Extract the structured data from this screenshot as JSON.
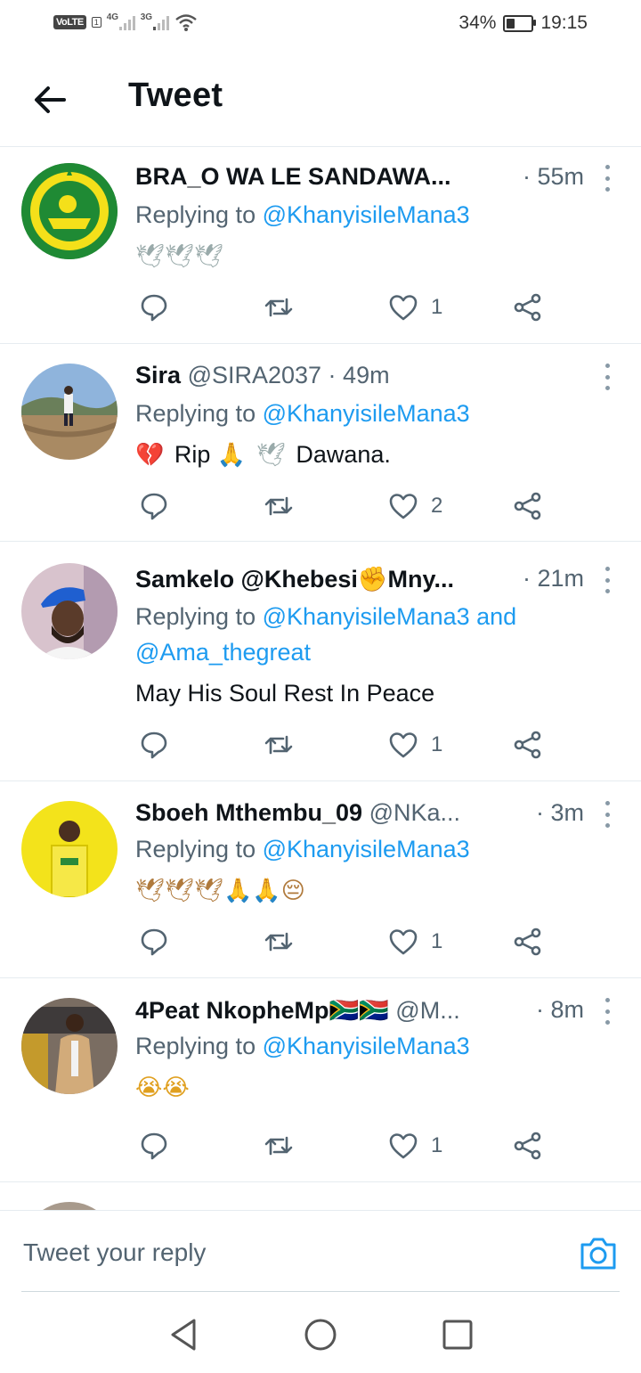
{
  "status_bar": {
    "volte": "VoLTE",
    "sim_slot": "1",
    "net1": "4G",
    "net2": "3G",
    "battery_pct": "34%",
    "battery_level": 0.34,
    "time": "19:15"
  },
  "header": {
    "back_icon": "arrow-left-icon",
    "title": "Tweet"
  },
  "tweets": [
    {
      "name": "BRA_O WA LE SANDAWA...",
      "handle": "",
      "time": "· 55m",
      "replying_prefix": "Replying to ",
      "mentions": "@KhanyisileMana3",
      "mentions2": "",
      "body_text": "",
      "body_emoji": "🕊🕊🕊",
      "body_suffix": "",
      "likes": "1",
      "avatar_color": "#1e7a2e"
    },
    {
      "name": "Sira",
      "handle": "@SIRA2037 · 49m",
      "time": "",
      "replying_prefix": "Replying to ",
      "mentions": "@KhanyisileMana3",
      "mentions2": "",
      "body_text": "Rip",
      "body_emoji": "💔",
      "body_suffix": "Dawana.",
      "likes": "2",
      "avatar_color": "#8aa6c8"
    },
    {
      "name": "Samkelo @Khebesi✊Mny...",
      "handle": "",
      "time": "· 21m",
      "replying_prefix": "Replying to ",
      "mentions": "@KhanyisileMana3 and",
      "mentions2": "@Ama_thegreat",
      "body_text": "May His Soul Rest In Peace",
      "body_emoji": "",
      "body_suffix": "",
      "likes": "1",
      "avatar_color": "#c9b8c2"
    },
    {
      "name": "Sboeh Mthembu_09",
      "handle": "@NKa...",
      "time": "· 3m",
      "replying_prefix": "Replying to ",
      "mentions": "@KhanyisileMana3",
      "mentions2": "",
      "body_text": "",
      "body_emoji": "🕊🕊🕊🙏🙏😔",
      "body_suffix": "",
      "likes": "1",
      "avatar_color": "#f2e21c"
    },
    {
      "name": "4Peat NkopheMp🇿🇦🇿🇦",
      "handle": "@M...",
      "time": "· 8m",
      "replying_prefix": "Replying to ",
      "mentions": "@KhanyisileMana3",
      "mentions2": "",
      "body_text": "",
      "body_emoji": "😭😭",
      "body_suffix": "",
      "likes": "1",
      "avatar_color": "#6b5a4a"
    }
  ],
  "compose": {
    "placeholder": "Tweet your reply",
    "camera_icon": "camera-icon"
  },
  "nav": {
    "back": "triangle-back-icon",
    "home": "circle-home-icon",
    "recents": "square-recents-icon"
  },
  "colors": {
    "accent": "#1d9bf0",
    "secondary_text": "#536471",
    "divider": "#e6ecf0"
  }
}
